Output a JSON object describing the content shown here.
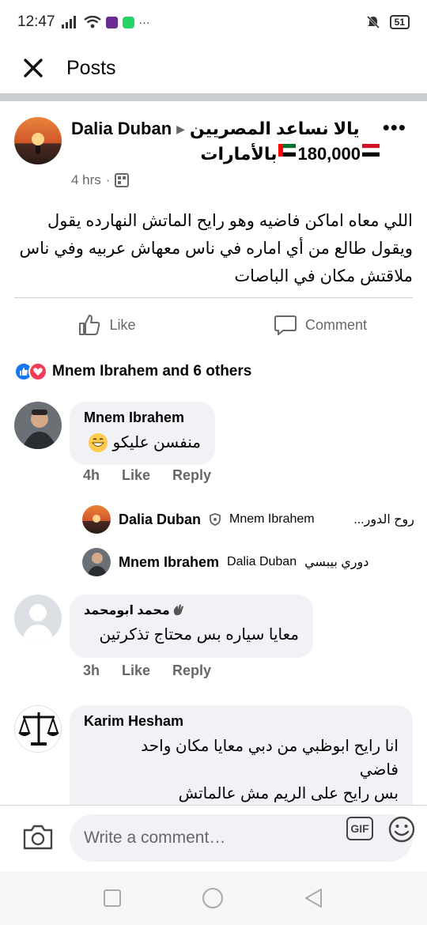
{
  "status": {
    "time": "12:47",
    "battery": "51"
  },
  "header": {
    "title": "Posts"
  },
  "post": {
    "author": "Dalia Duban",
    "group_name": "يالا نساعد المصريين",
    "group_line2_count": "180,000",
    "group_line2_suffix": "بالأمارات",
    "time": "4 hrs",
    "body": "اللي معاه اماكن فاضيه وهو رايح الماتش النهارده يقول ويقول طالع من أي اماره في ناس معهاش عربيه وفي ناس ملاقتش مكان في الباصات"
  },
  "actions": {
    "like": "Like",
    "comment": "Comment"
  },
  "reactions": {
    "summary": "Mnem Ibrahem and 6 others"
  },
  "comments": [
    {
      "name": "Mnem Ibrahem",
      "text": "منفسن عليكو",
      "time": "4h",
      "like": "Like",
      "reply": "Reply"
    },
    {
      "name": "محمد ابومحمد",
      "text": "معايا سياره بس محتاج تذكرتين",
      "time": "3h",
      "like": "Like",
      "reply": "Reply"
    },
    {
      "name": "Karim Hesham",
      "text_lines": [
        "انا رايح ابوظبي من دبي معايا مكان واحد",
        "فاضي",
        "بس رايح على الريم مش عالماتش"
      ]
    }
  ],
  "replies": [
    {
      "name": "Dalia Duban",
      "mention": "Mnem Ibrahem",
      "text": "روح الدور..."
    },
    {
      "name": "Mnem Ibrahem",
      "mention": "Dalia Duban",
      "text": "دوري بيبسي"
    }
  ],
  "compose": {
    "placeholder": "Write a comment…",
    "gif": "GIF"
  }
}
